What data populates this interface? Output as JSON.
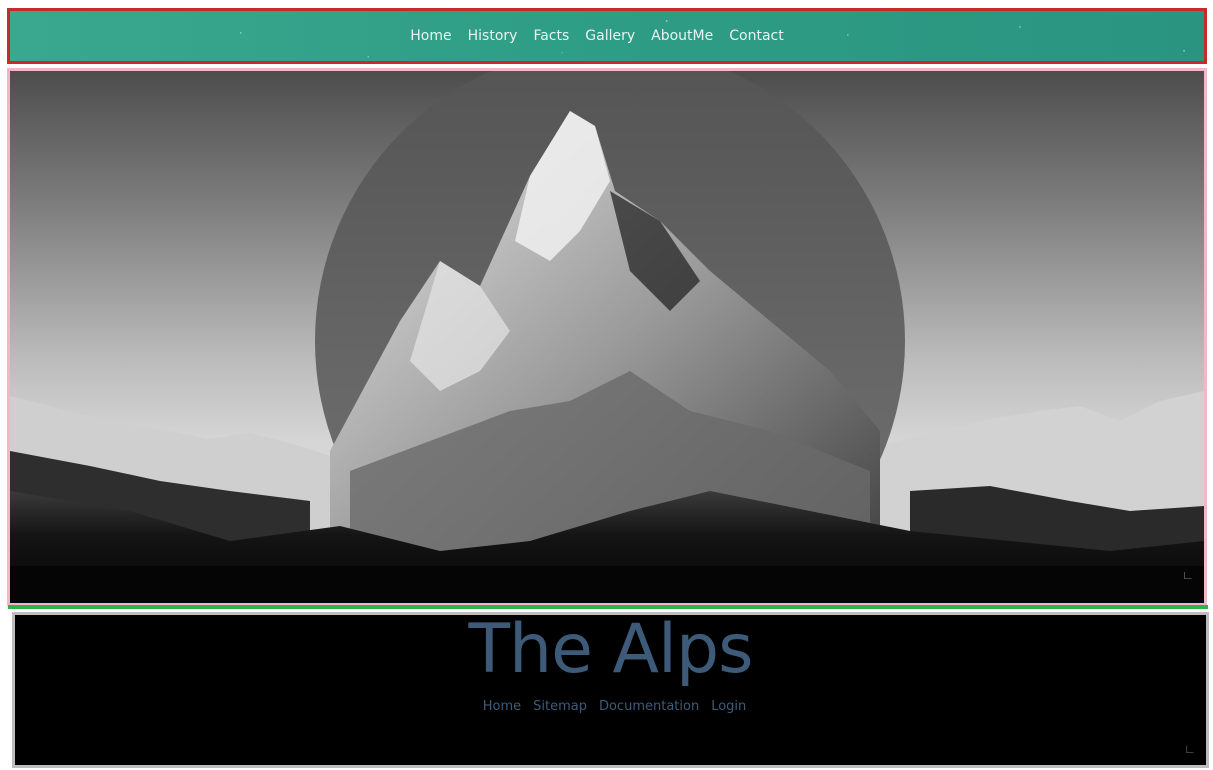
{
  "nav": {
    "items": [
      {
        "label": "Home"
      },
      {
        "label": "History"
      },
      {
        "label": "Facts"
      },
      {
        "label": "Gallery"
      },
      {
        "label": "AboutMe"
      },
      {
        "label": "Contact"
      }
    ]
  },
  "hero": {
    "image": "mountain-landscape"
  },
  "footer": {
    "title": "The Alps",
    "links": [
      {
        "label": "Home"
      },
      {
        "label": "Sitemap"
      },
      {
        "label": "Documentation"
      },
      {
        "label": "Login"
      }
    ]
  },
  "colors": {
    "nav_bg": "#2f9e86",
    "nav_border": "#c8292b",
    "hero_border": "#f3b6c5",
    "separator": "#2db34a",
    "footer_bg": "#000000",
    "footer_text": "#3d5a78"
  }
}
